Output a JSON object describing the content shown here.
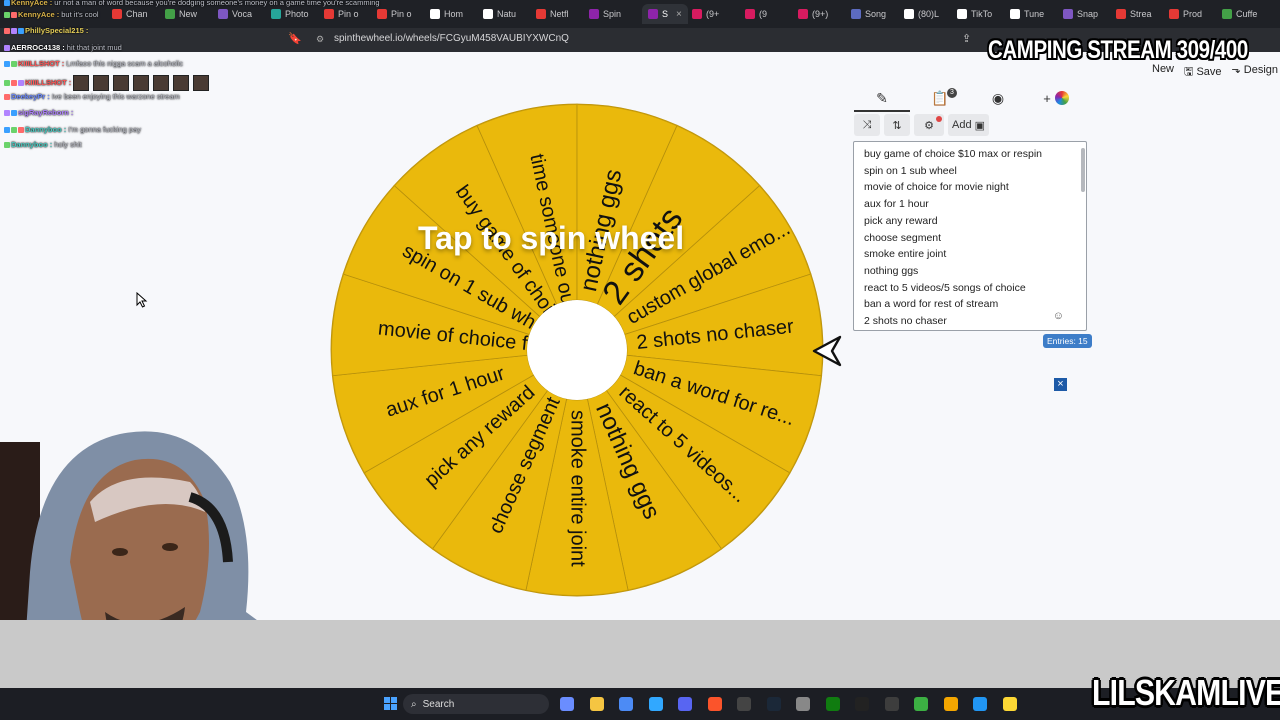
{
  "browser": {
    "tabs": [
      {
        "label": "Chan",
        "color": "#e53935"
      },
      {
        "label": "New",
        "color": "#43a047"
      },
      {
        "label": "Voca",
        "color": "#7e57c2"
      },
      {
        "label": "Photo",
        "color": "#26a69a"
      },
      {
        "label": "Pin o",
        "color": "#e53935"
      },
      {
        "label": "Pin o",
        "color": "#e53935"
      },
      {
        "label": "Hom",
        "color": "#ffffff"
      },
      {
        "label": "Natu",
        "color": "#ffffff"
      },
      {
        "label": "Netfl",
        "color": "#e53935"
      },
      {
        "label": "Spin",
        "color": "#8e24aa"
      },
      {
        "label": "S",
        "color": "#8e24aa",
        "active": true
      },
      {
        "label": "(9+",
        "color": "#d81b60"
      },
      {
        "label": "(9",
        "color": "#d81b60"
      },
      {
        "label": "(9+)",
        "color": "#d81b60"
      },
      {
        "label": "Song",
        "color": "#5c6bc0"
      },
      {
        "label": "(80)L",
        "color": "#ffffff"
      },
      {
        "label": "TikTo",
        "color": "#ffffff"
      },
      {
        "label": "Tune",
        "color": "#ffffff"
      },
      {
        "label": "Snap",
        "color": "#7e57c2"
      },
      {
        "label": "Strea",
        "color": "#e53935"
      },
      {
        "label": "Prod",
        "color": "#e53935"
      },
      {
        "label": "Cuffe",
        "color": "#43a047"
      }
    ],
    "url": "spinthewheel.io/wheels/FCGyuM458VAUBIYXWCnQ"
  },
  "chat": {
    "messages": [
      {
        "user": "KennyAce",
        "text": "ur not a man of word because you're dodging someone's money on a game time you're scamming",
        "color": "#d9b34a"
      },
      {
        "user": "KennyAce",
        "text": "but it's cool",
        "color": "#d9b34a"
      },
      {
        "user": "PhillySpecial215",
        "text": "",
        "color": "#e6cf5a"
      },
      {
        "user": "AERROC4138",
        "text": "hit that joint mud",
        "color": "#ffffff"
      },
      {
        "user": "KIIILLSHOT",
        "text": "Lmfaoo this nigga scam a alcoholic",
        "color": "#ff5a5a"
      },
      {
        "user": "KIIILLSHOT",
        "text": "",
        "color": "#ff5a5a"
      },
      {
        "user": "DeekeyPr",
        "text": "Ive been enjoying this warzone stream",
        "color": "#6e8cff"
      },
      {
        "user": "sigRayReborn",
        "text": "",
        "color": "#b184ff"
      },
      {
        "user": "Dannyboo",
        "text": "I'm gonna fucking pay",
        "color": "#4ecdc4"
      },
      {
        "user": "Dannyboo",
        "text": "holy shit",
        "color": "#4ecdc4"
      }
    ]
  },
  "overlay": {
    "stream_title": "CAMPING STREAM 309/400",
    "brand": "LILSKAMLIVE"
  },
  "app": {
    "header_actions": {
      "new": "New",
      "save": "Save",
      "design": "Design"
    },
    "tap_label": "Tap to spin wheel",
    "wheel_color": "#eab90c",
    "wheel_segments": [
      "2 shots",
      "custom global emo...",
      "2 shots no chaser",
      "ban a word for re...",
      "react to 5 videos...",
      "nothing ggs",
      "smoke entire joint",
      "choose segment",
      "pick any reward",
      "aux for 1 hour",
      "movie of choice f...",
      "spin on 1 sub whe...",
      "buy game of choic...",
      "time someone out ...",
      "nothing ggs"
    ],
    "panel_tab_badge": "3",
    "add_label": "Add",
    "entries": [
      "buy game of choice $10 max or respin",
      "spin on 1 sub wheel",
      "movie of choice for movie night",
      "aux for 1 hour",
      "pick any reward",
      "choose segment",
      "smoke entire joint",
      "nothing ggs",
      "react to 5 videos/5 songs of choice",
      "ban a word for rest of stream",
      "2 shots no chaser"
    ],
    "entries_count": "Entries: 15",
    "close_label": "×"
  },
  "taskbar": {
    "search_label": "Search",
    "icons": [
      "copilot-icon",
      "files-icon",
      "store-icon",
      "photoshop-icon",
      "discord-icon",
      "brave-icon",
      "obs-icon",
      "steam-icon",
      "app-icon",
      "xbox-icon",
      "capcut-icon",
      "4k-icon",
      "utorrent-icon",
      "fl-icon",
      "app2-icon",
      "notes-icon"
    ]
  }
}
